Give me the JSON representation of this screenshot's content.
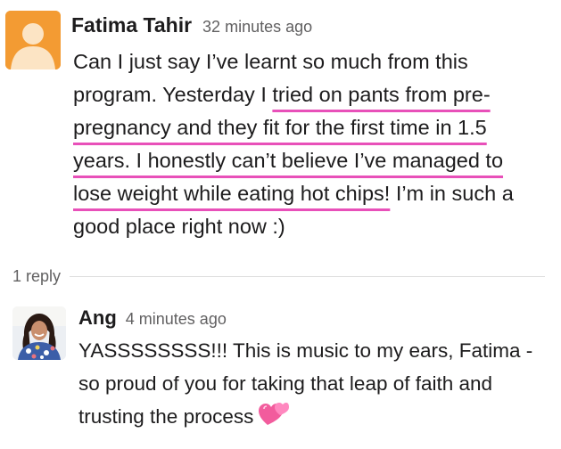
{
  "message": {
    "author": "Fatima Tahir",
    "time": "32 minutes ago",
    "avatar": "default-user-avatar",
    "text_lines": [
      [
        "Can I just say I’ve learnt so much from this"
      ],
      [
        "program. Yesterday I ",
        "tried on pants from pre-"
      ],
      [
        "pregnancy and they fit for the first time in 1.5"
      ],
      [
        "years. I honestly can’t believe I’ve managed to"
      ],
      [
        "lose weight while eating hot chips!",
        " I’m in such a"
      ],
      [
        "good place right now :)"
      ]
    ],
    "highlight_color": "#e850b9"
  },
  "thread": {
    "reply_count": "1 reply"
  },
  "reply": {
    "author": "Ang",
    "time": "4 minutes ago",
    "avatar": "user-photo-avatar",
    "text_lines": [
      "YASSSSSSSS!!!  This is music to my ears, Fatima -",
      "so proud of you for taking that leap of faith and",
      "trusting the process"
    ],
    "emoji": "two-hearts-icon"
  },
  "colors": {
    "avatar_orange": "#f39b33",
    "text": "#1d1c1d",
    "muted": "#616061"
  }
}
